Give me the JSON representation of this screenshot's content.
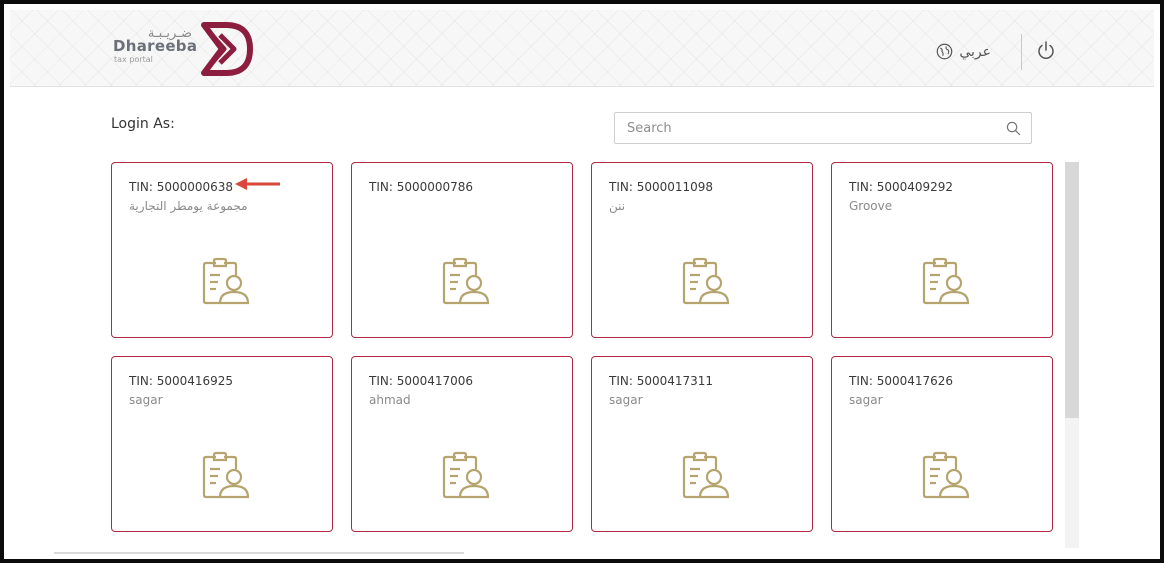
{
  "header": {
    "logo_arabic": "ضـريـبـة",
    "logo_name": "Dhareeba",
    "logo_sub": "tax portal",
    "lang_label": "عربي"
  },
  "page": {
    "login_as": "Login As:",
    "search_placeholder": "Search"
  },
  "cards": [
    {
      "tin": "TIN: 5000000638",
      "name": "مجموعة يومطر التجارية"
    },
    {
      "tin": "TIN: 5000000786",
      "name": ""
    },
    {
      "tin": "TIN: 5000011098",
      "name": "ننن"
    },
    {
      "tin": "TIN: 5000409292",
      "name": "Groove"
    },
    {
      "tin": "TIN: 5000416925",
      "name": "sagar"
    },
    {
      "tin": "TIN: 5000417006",
      "name": "ahmad"
    },
    {
      "tin": "TIN: 5000417311",
      "name": "sagar"
    },
    {
      "tin": "TIN: 5000417626",
      "name": "sagar"
    }
  ],
  "icons": {
    "card_icon": "clipboard-user-icon",
    "language": "globe-icon",
    "logout": "power-icon",
    "search": "search-icon"
  },
  "colors": {
    "brand": "#8c1d3e",
    "card_border": "#b02a44",
    "icon_gold": "#b5a46e",
    "annotation_arrow": "#d9463a"
  }
}
